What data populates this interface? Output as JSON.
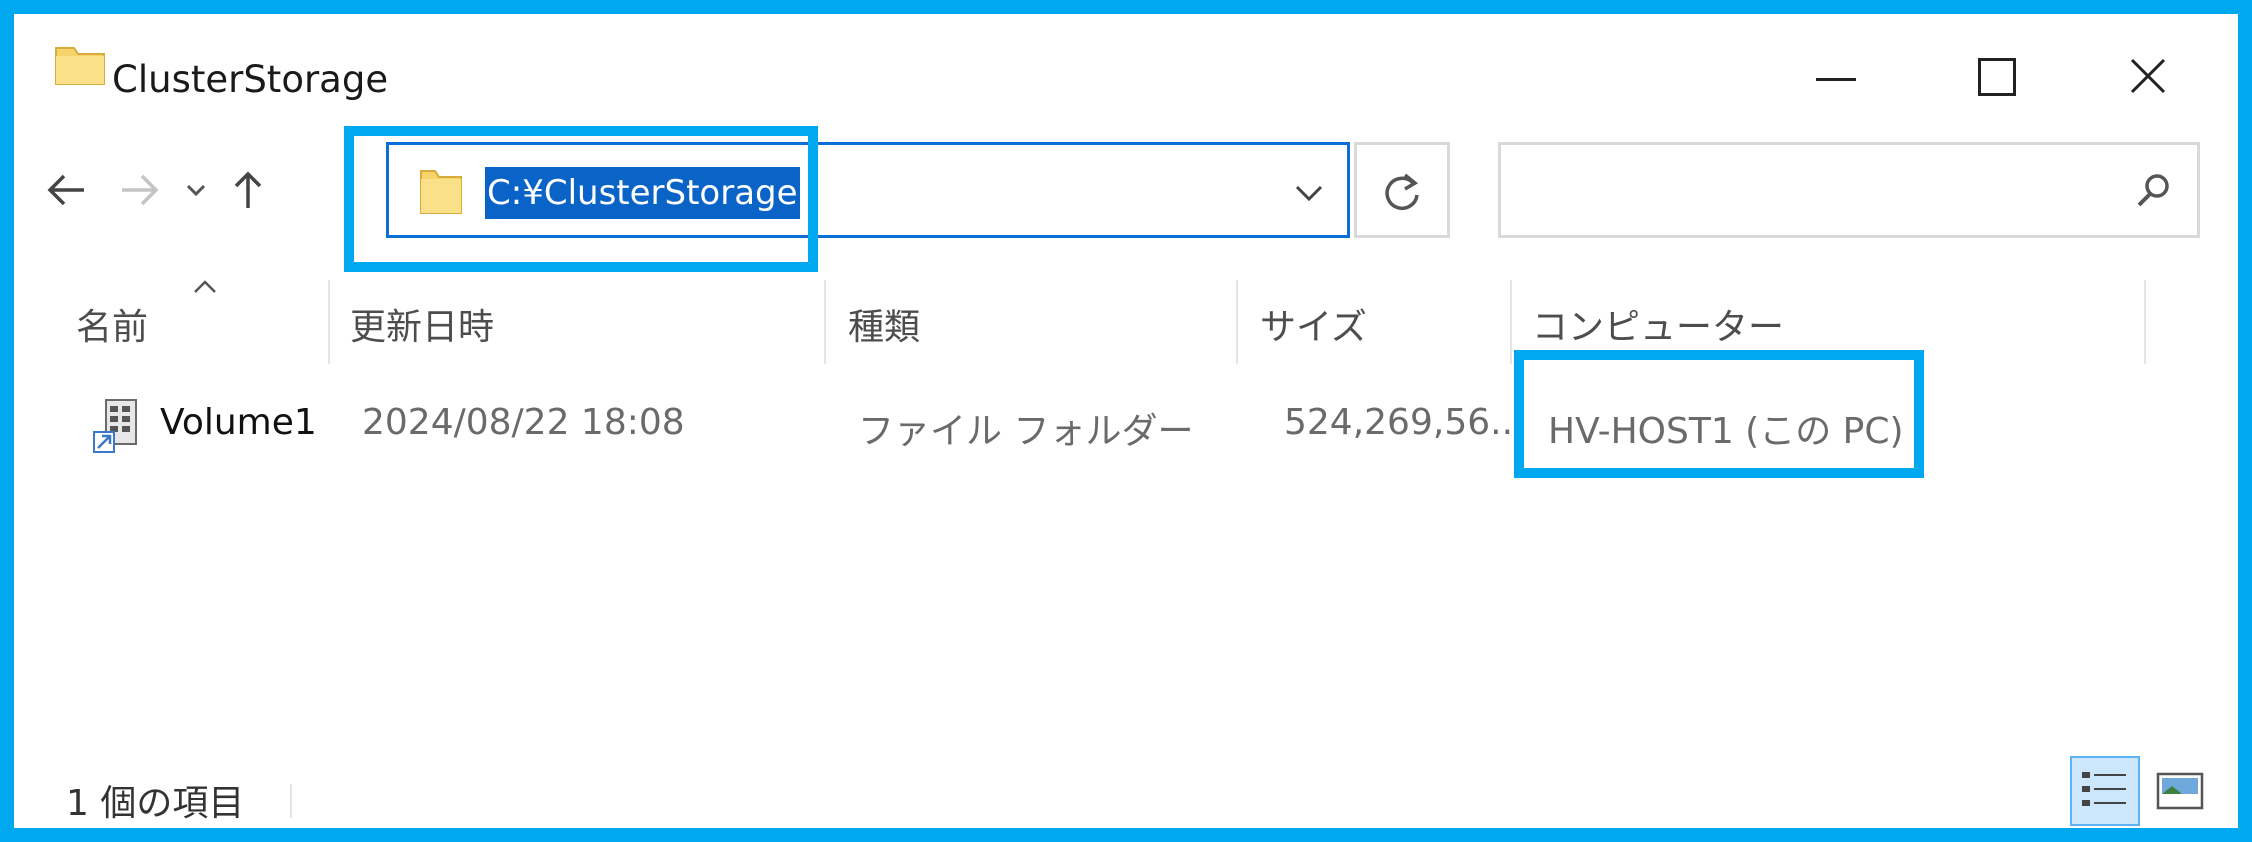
{
  "window": {
    "title": "ClusterStorage",
    "icon": "folder-icon",
    "controls": {
      "minimize": "minimize-icon",
      "maximize": "maximize-icon",
      "close": "close-icon"
    }
  },
  "nav": {
    "back": "back-arrow-icon",
    "forward": "forward-arrow-icon",
    "recent": "chevron-down-icon",
    "up": "up-arrow-icon"
  },
  "address": {
    "path": "C:¥ClusterStorage",
    "icon": "folder-icon"
  },
  "search": {
    "value": "",
    "icon": "search-icon"
  },
  "columns": {
    "name": "名前",
    "modified": "更新日時",
    "type": "種類",
    "size": "サイズ",
    "computer": "コンピューター"
  },
  "rows": [
    {
      "name": "Volume1",
      "modified": "2024/08/22 18:08",
      "type": "ファイル フォルダー",
      "size": "524,269,56...",
      "computer": "HV-HOST1 (この PC)",
      "icon": "cluster-volume-icon"
    }
  ],
  "status": {
    "item_count": "1 個の項目"
  },
  "colors": {
    "highlight": "#00a8f0",
    "selection": "#0a64c8",
    "folder": "#f6d36b"
  }
}
